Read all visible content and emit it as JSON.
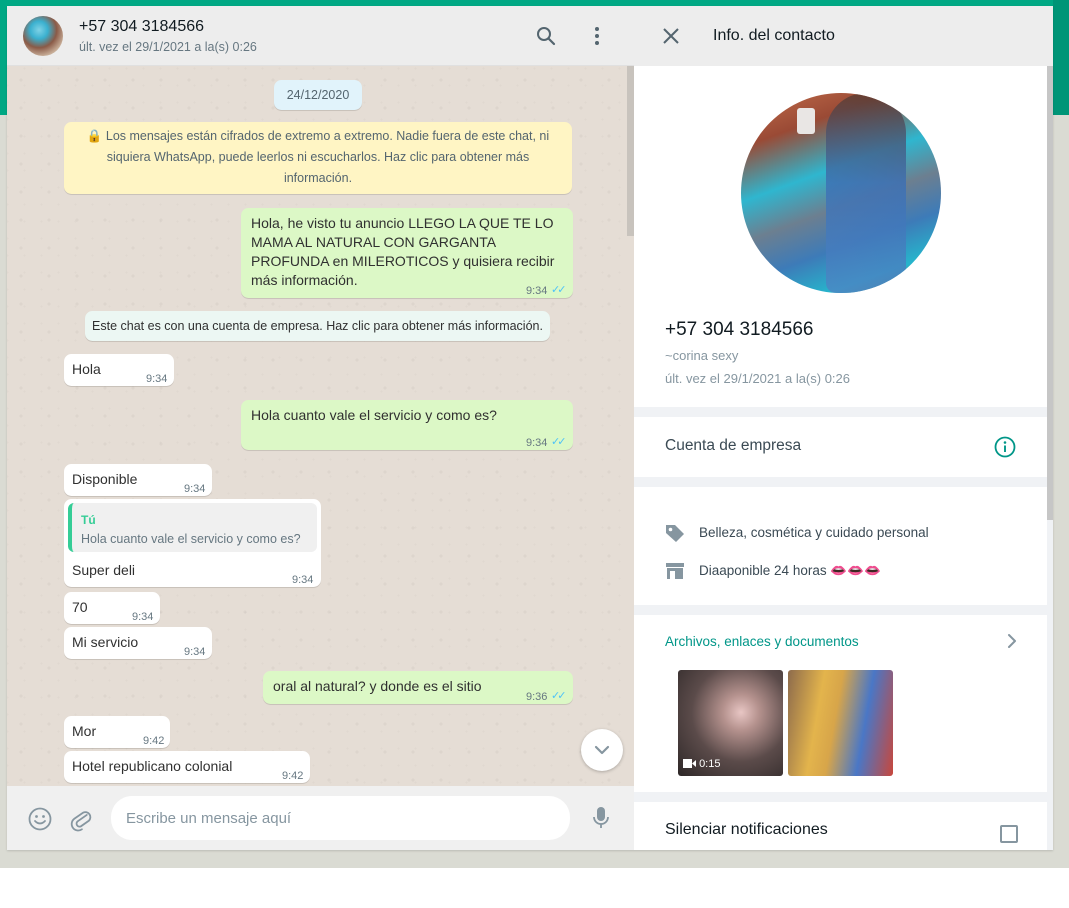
{
  "chat_header": {
    "title": "+57 304 3184566",
    "subtitle": "últ. vez el 29/1/2021 a la(s) 0:26",
    "icons": [
      "avatar",
      "search-icon",
      "menu-dots-icon"
    ]
  },
  "messages": {
    "date_chip": "24/12/2020",
    "encryption_notice": "🔒 Los mensajes están cifrados de extremo a extremo. Nadie fuera de este chat, ni siquiera WhatsApp, puede leerlos ni escucharlos. Haz clic para obtener más información.",
    "business_notice": "Este chat es con una cuenta de empresa. Haz clic para obtener más información.",
    "m1": {
      "text": "Hola, he visto tu anuncio LLEGO LA QUE TE LO MAMA AL NATURAL CON GARGANTA PROFUNDA en MILEROTICOS y quisiera recibir más información.",
      "time": "9:34"
    },
    "m2": {
      "text": "Hola",
      "time": "9:34"
    },
    "m3": {
      "text": "Hola cuanto vale el servicio y como es?",
      "time": "9:34"
    },
    "m4": {
      "text": "Disponible",
      "time": "9:34"
    },
    "m5": {
      "quote_author": "Tú",
      "quote_text": "Hola cuanto vale el servicio y como es?",
      "text": "Super deli",
      "time": "9:34"
    },
    "m6": {
      "text": "70",
      "time": "9:34"
    },
    "m7": {
      "text": "Mi servicio",
      "time": "9:34"
    },
    "m8": {
      "text": "oral al natural? y donde es el sitio",
      "time": "9:36"
    },
    "m9": {
      "text": "Mor",
      "time": "9:42"
    },
    "m10": {
      "text": "Hotel republicano colonial",
      "time": "9:42"
    },
    "read_ticks": "✓✓"
  },
  "composer": {
    "placeholder": "Escribe un mensaje aquí",
    "icons": [
      "emoji-icon",
      "attach-icon",
      "mic-icon"
    ]
  },
  "info_panel": {
    "title": "Info. del contacto",
    "phone": "+57 304 3184566",
    "name": "~corina sexy",
    "last_seen": "últ. vez el 29/1/2021 a la(s) 0:26",
    "business_account_label": "Cuenta de empresa",
    "category": "Belleza, cosmética y cuidado personal",
    "hours": "Diaaponible 24 horas 👄👄👄",
    "media_label": "Archivos, enlaces y documentos",
    "media_items": [
      {
        "type": "video",
        "duration": "0:15"
      },
      {
        "type": "image"
      }
    ],
    "mute_label": "Silenciar notificaciones",
    "mute_checked": false
  },
  "colors": {
    "accent": "#00a884",
    "outgoing_bubble": "#dcf8c6",
    "incoming_bubble": "#ffffff",
    "read_ticks": "#4fc3f7",
    "info_icon": "#009688"
  }
}
